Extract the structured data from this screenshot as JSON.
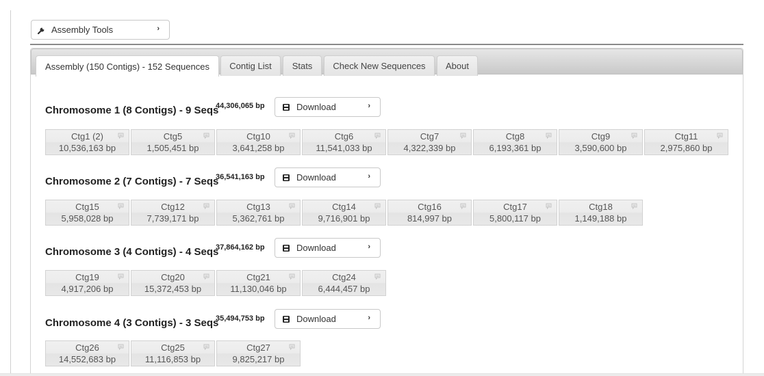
{
  "toolbar": {
    "tools_label": "Assembly Tools",
    "tools_icon": "wrench-icon",
    "tools_chevron": "›"
  },
  "tabs": [
    {
      "label": "Assembly (150 Contigs) - 152 Sequences",
      "active": true
    },
    {
      "label": "Contig List",
      "active": false
    },
    {
      "label": "Stats",
      "active": false
    },
    {
      "label": "Check New Sequences",
      "active": false
    },
    {
      "label": "About",
      "active": false
    }
  ],
  "download_label": "Download",
  "download_chevron": "›",
  "chromosomes": [
    {
      "title": "Chromosome 1 (8 Contigs) - 9 Seqs",
      "total": "44,306,065 bp",
      "contigs": [
        {
          "name": "Ctg1 (2)",
          "length": "10,536,163 bp"
        },
        {
          "name": "Ctg5",
          "length": "1,505,451 bp"
        },
        {
          "name": "Ctg10",
          "length": "3,641,258 bp"
        },
        {
          "name": "Ctg6",
          "length": "11,541,033 bp"
        },
        {
          "name": "Ctg7",
          "length": "4,322,339 bp"
        },
        {
          "name": "Ctg8",
          "length": "6,193,361 bp"
        },
        {
          "name": "Ctg9",
          "length": "3,590,600 bp"
        },
        {
          "name": "Ctg11",
          "length": "2,975,860 bp"
        }
      ]
    },
    {
      "title": "Chromosome 2 (7 Contigs) - 7 Seqs",
      "total": "36,541,163 bp",
      "contigs": [
        {
          "name": "Ctg15",
          "length": "5,958,028 bp"
        },
        {
          "name": "Ctg12",
          "length": "7,739,171 bp"
        },
        {
          "name": "Ctg13",
          "length": "5,362,761 bp"
        },
        {
          "name": "Ctg14",
          "length": "9,716,901 bp"
        },
        {
          "name": "Ctg16",
          "length": "814,997 bp"
        },
        {
          "name": "Ctg17",
          "length": "5,800,117 bp"
        },
        {
          "name": "Ctg18",
          "length": "1,149,188 bp"
        }
      ]
    },
    {
      "title": "Chromosome 3 (4 Contigs) - 4 Seqs",
      "total": "37,864,162 bp",
      "contigs": [
        {
          "name": "Ctg19",
          "length": "4,917,206 bp"
        },
        {
          "name": "Ctg20",
          "length": "15,372,453 bp"
        },
        {
          "name": "Ctg21",
          "length": "11,130,046 bp"
        },
        {
          "name": "Ctg24",
          "length": "6,444,457 bp"
        }
      ]
    },
    {
      "title": "Chromosome 4 (3 Contigs) - 3 Seqs",
      "total": "35,494,753 bp",
      "contigs": [
        {
          "name": "Ctg26",
          "length": "14,552,683 bp"
        },
        {
          "name": "Ctg25",
          "length": "11,116,853 bp"
        },
        {
          "name": "Ctg27",
          "length": "9,825,217 bp"
        }
      ]
    }
  ]
}
